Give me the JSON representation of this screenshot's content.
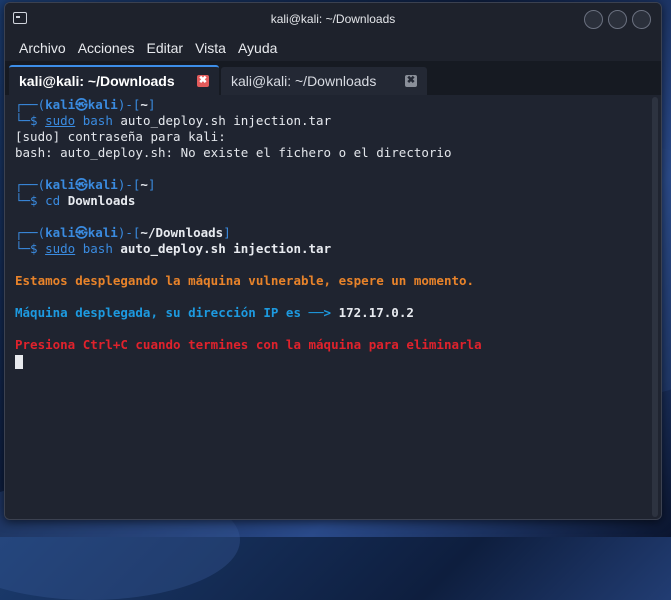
{
  "window": {
    "title": "kali@kali: ~/Downloads"
  },
  "menu": [
    "Archivo",
    "Acciones",
    "Editar",
    "Vista",
    "Ayuda"
  ],
  "tabs": [
    {
      "label": "kali@kali: ~/Downloads",
      "close": "✖"
    },
    {
      "label": "kali@kali: ~/Downloads",
      "close": "✖"
    }
  ],
  "prompt": {
    "user": "kali",
    "at": "㉿",
    "host": "kali",
    "dash_open": "┌──(",
    "close_paren": ")-[",
    "dollar": "└─$ "
  },
  "blocks": [
    {
      "dir": "~",
      "cmd_parts": [
        "sudo",
        " bash ",
        "auto_deploy.sh",
        " injection.tar"
      ],
      "output": [
        "[sudo] contraseña para kali:",
        "bash: auto_deploy.sh: No existe el fichero o el directorio"
      ]
    },
    {
      "dir": "~",
      "cmd_parts": [
        "cd",
        " ",
        "Downloads",
        ""
      ],
      "output": []
    },
    {
      "dir": "~/Downloads",
      "cmd_parts": [
        "sudo",
        " bash ",
        "auto_deploy.sh",
        " injection.tar"
      ],
      "output": []
    }
  ],
  "messages": {
    "deploying": "Estamos desplegando la máquina vulnerable, espere un momento.",
    "deployed_prefix": "Máquina desplegada, su dirección IP es ──> ",
    "ip": "172.17.0.2",
    "stop": "Presiona Ctrl+C cuando termines con la máquina para eliminarla"
  }
}
